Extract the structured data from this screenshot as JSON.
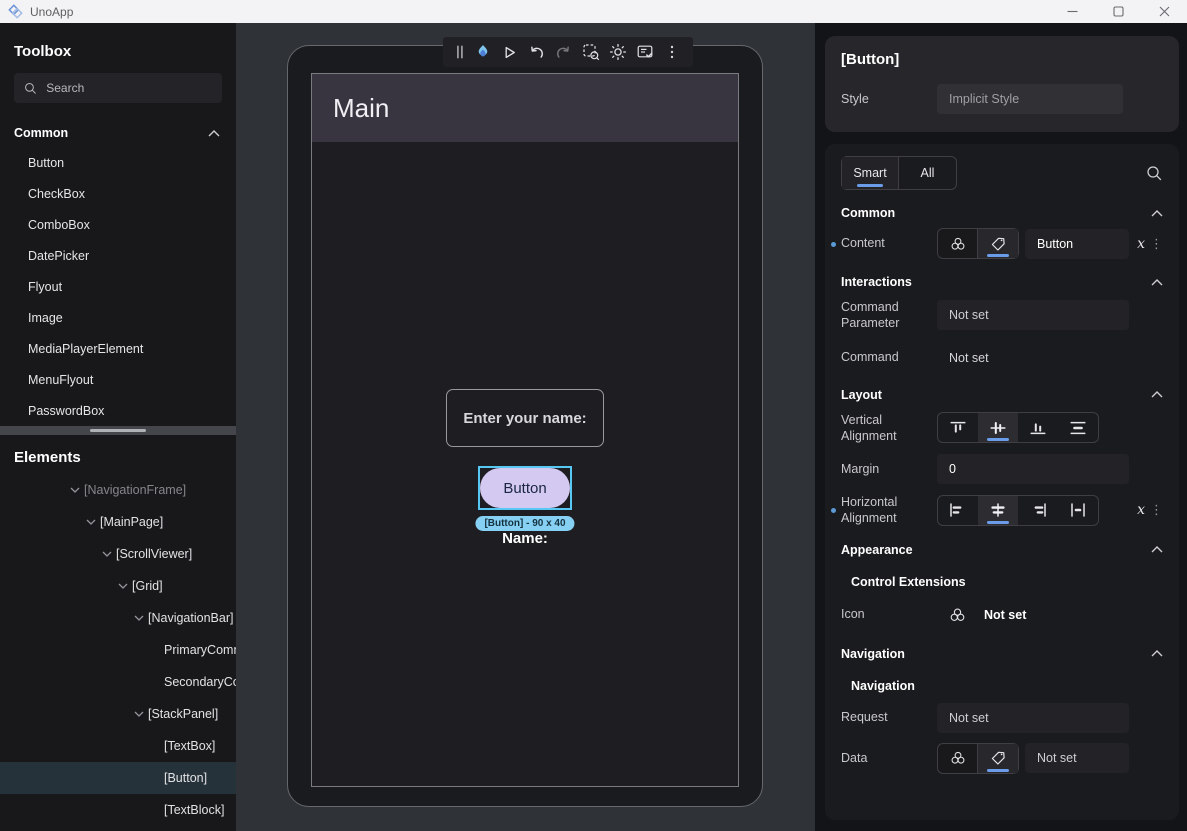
{
  "titlebar": {
    "app_name": "UnoApp"
  },
  "toolbox": {
    "title": "Toolbox",
    "search_placeholder": "Search",
    "section_label": "Common",
    "items": [
      "Button",
      "CheckBox",
      "ComboBox",
      "DatePicker",
      "Flyout",
      "Image",
      "MediaPlayerElement",
      "MenuFlyout",
      "PasswordBox"
    ]
  },
  "elements": {
    "title": "Elements",
    "tree": [
      {
        "label": "[NavigationFrame]",
        "depth": 0,
        "dim": true
      },
      {
        "label": "[MainPage]",
        "depth": 1
      },
      {
        "label": "[ScrollViewer]",
        "depth": 2
      },
      {
        "label": "[Grid]",
        "depth": 3
      },
      {
        "label": "[NavigationBar]",
        "depth": 4
      },
      {
        "label": "PrimaryComm",
        "depth": 5,
        "leaf": true
      },
      {
        "label": "SecondaryCo",
        "depth": 5,
        "leaf": true
      },
      {
        "label": "[StackPanel]",
        "depth": 4
      },
      {
        "label": "[TextBox]",
        "depth": 5,
        "leaf": true
      },
      {
        "label": "[Button]",
        "depth": 5,
        "leaf": true,
        "selected": true
      },
      {
        "label": "[TextBlock]",
        "depth": 5,
        "leaf": true
      }
    ]
  },
  "designer": {
    "toolbar_icons": [
      "drag-handle",
      "hot-reload-flame",
      "play",
      "undo",
      "redo",
      "element-picker",
      "theme-toggle",
      "panel-check",
      "more-menu"
    ],
    "page_title": "Main",
    "textbox_text": "Enter your name:",
    "button_label": "Button",
    "selection_badge": "[Button] - 90 x 40",
    "name_label": "Name:"
  },
  "inspector": {
    "selected_element": "[Button]",
    "style_label": "Style",
    "style_value": "Implicit Style",
    "tabs": {
      "options": [
        "Smart",
        "All"
      ],
      "active": "Smart"
    },
    "common": {
      "title": "Common",
      "content_label": "Content",
      "content_value": "Button",
      "content_editor_mode": "tag"
    },
    "interactions": {
      "title": "Interactions",
      "command_parameter_label": "Command Parameter",
      "command_parameter_value": "Not set",
      "command_label": "Command",
      "command_value": "Not set"
    },
    "layout": {
      "title": "Layout",
      "vertical_alignment_label": "Vertical Alignment",
      "vertical_alignment_options": [
        "top",
        "center",
        "bottom",
        "stretch"
      ],
      "vertical_alignment_selected": "center",
      "margin_label": "Margin",
      "margin_value": "0",
      "horizontal_alignment_label": "Horizontal Alignment",
      "horizontal_alignment_options": [
        "left",
        "center",
        "right",
        "stretch"
      ],
      "horizontal_alignment_selected": "center"
    },
    "appearance": {
      "title": "Appearance",
      "subsection": "Control Extensions",
      "icon_label": "Icon",
      "icon_value": "Not set"
    },
    "navigation": {
      "title": "Navigation",
      "subsection": "Navigation",
      "request_label": "Request",
      "request_value": "Not set",
      "data_label": "Data",
      "data_value": "Not set",
      "data_editor_mode": "tag"
    }
  },
  "icons": {
    "formula": "x",
    "more": "⋮"
  },
  "colors": {
    "accent_blue": "#6a9ce8",
    "selection_blue": "#57c7f3",
    "button_fill": "#d3c9f1",
    "badge_bg": "#85d0f3",
    "required_dot": "#5b9bd5",
    "titlebar_bg": "#f3f3f5",
    "canvas_bg": "#2f3338"
  }
}
